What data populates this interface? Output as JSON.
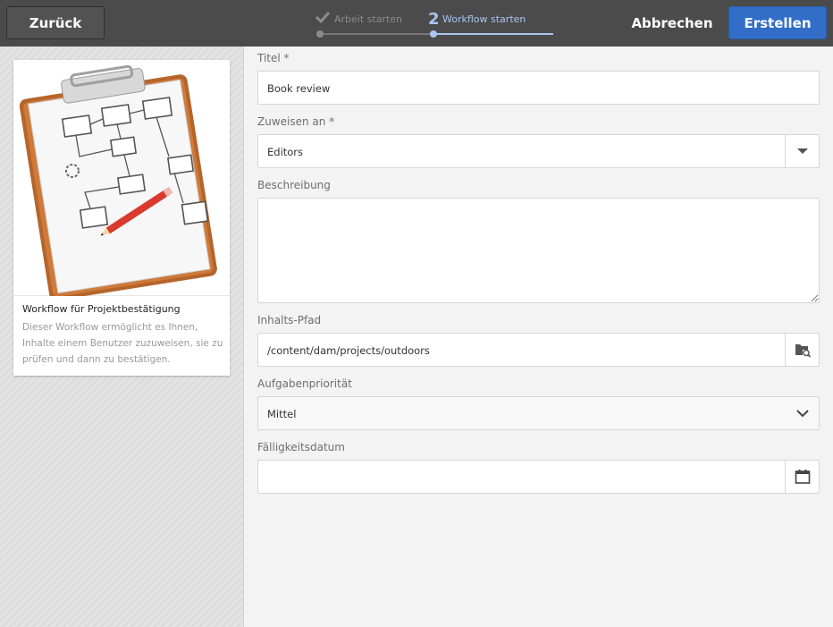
{
  "header": {
    "back_label": "Zurück",
    "cancel_label": "Abbrechen",
    "create_label": "Erstellen",
    "steps": [
      {
        "label": "Arbeit starten",
        "state": "done"
      },
      {
        "number": "2",
        "label": "Workflow starten",
        "state": "active"
      }
    ]
  },
  "card": {
    "title": "Workflow für Projektbestätigung",
    "description": "Dieser Workflow ermöglicht es Ihnen, Inhalte einem Benutzer zuzuweisen, sie zu prüfen und dann zu bestätigen."
  },
  "form": {
    "title_label": "Titel *",
    "title_value": "Book review",
    "assign_label": "Zuweisen an *",
    "assign_value": "Editors",
    "description_label": "Beschreibung",
    "description_value": "",
    "content_path_label": "Inhalts-Pfad",
    "content_path_value": "/content/dam/projects/outdoors",
    "priority_label": "Aufgabenpriorität",
    "priority_value": "Mittel",
    "due_date_label": "Fälligkeitsdatum",
    "due_date_value": ""
  },
  "colors": {
    "topbar": "#4b4b4b",
    "primary": "#326ec8",
    "active_step": "#a9c6f0"
  }
}
